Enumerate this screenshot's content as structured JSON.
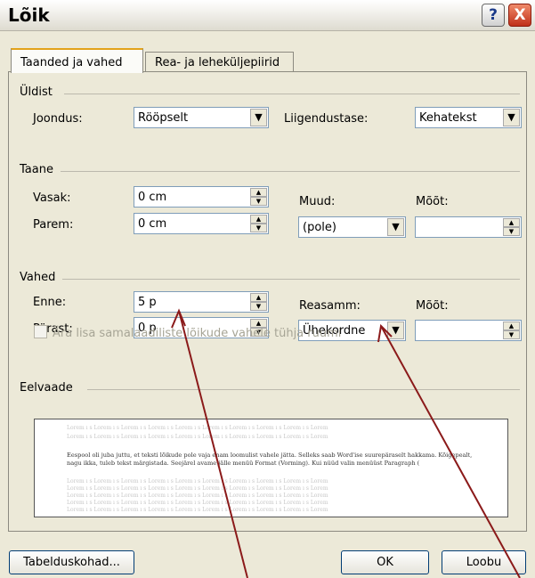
{
  "window": {
    "title": "Lõik",
    "help_label": "?",
    "close_label": "X"
  },
  "tabs": [
    {
      "label": "Taanded ja vahed"
    },
    {
      "label": "Rea- ja leheküljepiirid"
    }
  ],
  "general": {
    "heading": "Üldist",
    "alignment_label": "Joondus:",
    "alignment_value": "Rööpselt",
    "outline_label": "Liigendustase:",
    "outline_value": "Kehatekst"
  },
  "indent": {
    "heading": "Taane",
    "left_label": "Vasak:",
    "left_value": "0 cm",
    "right_label": "Parem:",
    "right_value": "0 cm",
    "special_label": "Muud:",
    "special_value": "(pole)",
    "by_label": "Mõõt:",
    "by_value": ""
  },
  "spacing": {
    "heading": "Vahed",
    "before_label": "Enne:",
    "before_value": "5 p",
    "after_label": "Pärast:",
    "after_value": "0 p",
    "line_label": "Reasamm:",
    "line_value": "Ühekordne",
    "at_label": "Mõõt:",
    "at_value": "",
    "dont_add_label": "Ära lisa samalaadiliste lõikude vahele tühja ruumi"
  },
  "preview": {
    "heading": "Eelvaade",
    "filler": "Lorem ı s Lorem ı s Lorem ı s Lorem ı s Lorem ı s Lorem ı s Lorem ı s Lorem ı s Lorem ı s Lorem",
    "sample_text": "Eespool oli juba juttu, et teksti lõikude pole vaja enam loomulist vahele jätta. Selleks saab Word'ise suurepäraselt hakkama. Kõigepealt, nagu ikka, tuleb tekst märgistada. Seejärel avame jälle menüü Format (Vorming). Kui nüüd valin menüüst Paragraph ("
  },
  "buttons": {
    "tabs_label": "Tabelduskohad...",
    "ok_label": "OK",
    "cancel_label": "Loobu"
  },
  "colors": {
    "annotation_arrow": "#8b1a1a"
  }
}
